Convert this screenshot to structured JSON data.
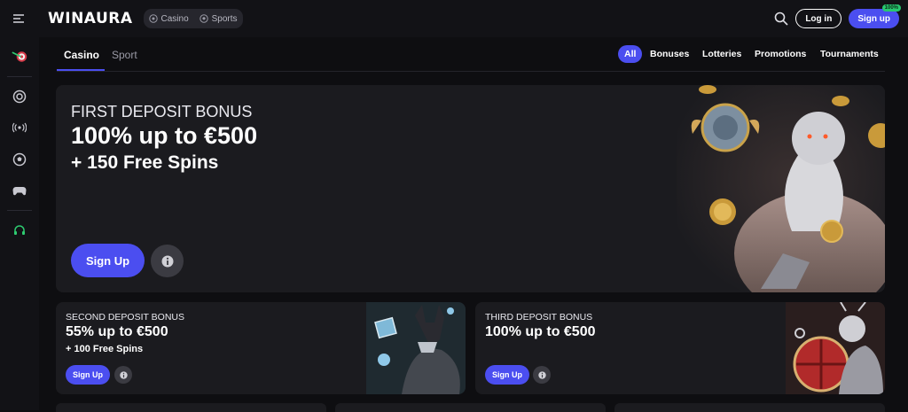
{
  "header": {
    "logo": "WINAURA",
    "modes": [
      {
        "label": "Casino",
        "icon": "dice-icon"
      },
      {
        "label": "Sports",
        "icon": "soccer-ball-icon"
      }
    ],
    "login_label": "Log in",
    "signup_label": "Sign up",
    "signup_badge": "100%"
  },
  "sidebar": {
    "icons": [
      "darts-icon",
      "casino-chip-icon",
      "live-broadcast-icon",
      "soccer-ball-icon",
      "gamepad-icon",
      "headset-icon"
    ]
  },
  "tabs": [
    {
      "label": "Casino",
      "active": true
    },
    {
      "label": "Sport",
      "active": false
    }
  ],
  "filters": [
    {
      "label": "All",
      "active": true
    },
    {
      "label": "Bonuses"
    },
    {
      "label": "Lotteries"
    },
    {
      "label": "Promotions"
    },
    {
      "label": "Tournaments"
    }
  ],
  "hero": {
    "line1": "FIRST DEPOSIT BONUS",
    "line2": "100% up to €500",
    "line3": "+ 150 Free Spins",
    "button": "Sign Up"
  },
  "cards": [
    {
      "line1": "SECOND DEPOSIT BONUS",
      "line2": "55% up to €500",
      "line3": "+ 100 Free Spins",
      "button": "Sign Up"
    },
    {
      "line1": "THIRD DEPOSIT BONUS",
      "line2": "100% up to €500",
      "line3": "",
      "button": "Sign Up"
    }
  ],
  "colors": {
    "accent": "#4b4ef0",
    "badge": "#28c76f",
    "background": "#0e0e11",
    "card": "#1b1b1f"
  }
}
